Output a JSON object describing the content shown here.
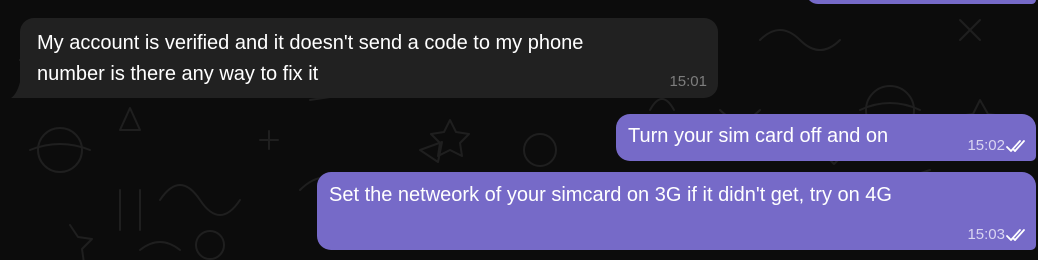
{
  "chat": {
    "messages": [
      {
        "direction": "incoming",
        "text": "My account is verified and it doesn't send a code to my phone\nnumber is there any way to fix it",
        "time": "15:01",
        "read_status": ""
      },
      {
        "direction": "outgoing",
        "text": "Turn your sim card off and on",
        "time": "15:02",
        "read_status": "read-double-check-icon"
      },
      {
        "direction": "outgoing",
        "text": "Set the netweork of your simcard on 3G if it didn't get, try on 4G",
        "time": "15:03",
        "read_status": "read-double-check-icon"
      }
    ]
  },
  "colors": {
    "background": "#0c0c0c",
    "incoming_bubble": "#212121",
    "outgoing_bubble": "#766ac8",
    "incoming_meta": "#7d7d7d",
    "outgoing_meta": "#d9d5f2"
  }
}
